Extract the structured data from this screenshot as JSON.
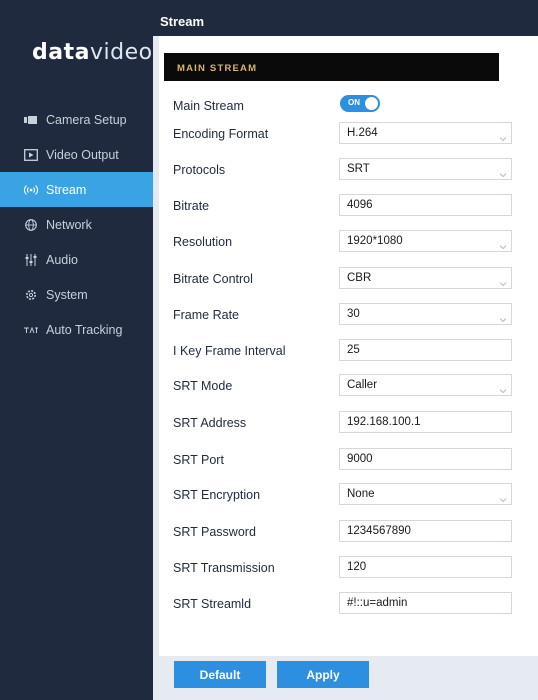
{
  "header": {
    "title": "Stream"
  },
  "logo": {
    "part1": "data",
    "part2": "video"
  },
  "sidebar": {
    "items": [
      {
        "label": "Camera Setup",
        "icon": "camera-icon"
      },
      {
        "label": "Video Output",
        "icon": "video-output-icon"
      },
      {
        "label": "Stream",
        "icon": "stream-icon",
        "active": true
      },
      {
        "label": "Network",
        "icon": "network-icon"
      },
      {
        "label": "Audio",
        "icon": "audio-icon"
      },
      {
        "label": "System",
        "icon": "gear-icon"
      },
      {
        "label": "Auto Tracking",
        "icon": "auto-tracking-icon"
      }
    ]
  },
  "section": {
    "title": "MAIN STREAM"
  },
  "form": {
    "main_stream": {
      "label": "Main Stream",
      "toggle": "ON"
    },
    "encoding_format": {
      "label": "Encoding Format",
      "value": "H.264"
    },
    "protocols": {
      "label": "Protocols",
      "value": "SRT"
    },
    "bitrate": {
      "label": "Bitrate",
      "value": "4096"
    },
    "resolution": {
      "label": "Resolution",
      "value": "1920*1080"
    },
    "bitrate_control": {
      "label": "Bitrate Control",
      "value": "CBR"
    },
    "frame_rate": {
      "label": "Frame Rate",
      "value": "30"
    },
    "key_frame_interval": {
      "label": "I Key Frame Interval",
      "value": "25"
    },
    "srt_mode": {
      "label": "SRT Mode",
      "value": "Caller"
    },
    "srt_address": {
      "label": "SRT Address",
      "value": "192.168.100.1"
    },
    "srt_port": {
      "label": "SRT Port",
      "value": "9000"
    },
    "srt_encryption": {
      "label": "SRT Encryption",
      "value": "None"
    },
    "srt_password": {
      "label": "SRT Password",
      "value": "1234567890"
    },
    "srt_transmission": {
      "label": "SRT Transmission",
      "value": "120"
    },
    "srt_streamid": {
      "label": "SRT Streamld",
      "value": "#!::u=admin"
    }
  },
  "buttons": {
    "default": "Default",
    "apply": "Apply"
  },
  "colors": {
    "sidebar": "#1f2a3f",
    "accent": "#2d8fe0",
    "active_nav": "#3aa3e3",
    "section_text": "#d9b56a"
  }
}
